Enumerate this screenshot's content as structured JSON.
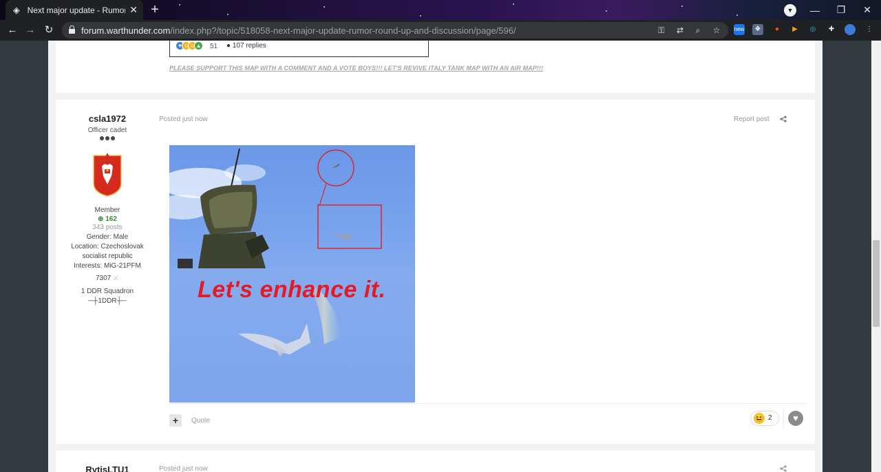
{
  "browser": {
    "tab_title": "Next major update - Rumor Rour",
    "url_host": "forum.warthunder.com",
    "url_path": "/index.php?/topic/518058-next-major-update-rumor-round-up-and-discussion/page/596/",
    "ext_new_label": "new"
  },
  "prev_post": {
    "reaction_count": "51",
    "replies": "107 replies",
    "signature": "PLEASE SUPPORT THIS MAP WITH A COMMENT AND A VOTE BOYS!!! LET'S REVIVE ITALY TANK MAP WITH AN AIR MAP!!!"
  },
  "post": {
    "author": {
      "name": "csla1972",
      "rank": "Officer cadet",
      "group": "Member",
      "reputation": "162",
      "posts": "343 posts",
      "gender": "Gender: Male",
      "location_1": "Location: Czechoslovak",
      "location_2": "socialist republic",
      "interests": "Interests: MiG-21PFM",
      "points": "7307",
      "squadron": "1 DDR Squadron",
      "squadron_tag": "─┼1DDR┼─"
    },
    "posted": "Posted just now",
    "report": "Report post",
    "image_caption": "Let's enhance it.",
    "quote_label": "Quote",
    "reaction_count": "2"
  },
  "next_post": {
    "author_name": "RytisLTU1",
    "posted": "Posted just now"
  }
}
